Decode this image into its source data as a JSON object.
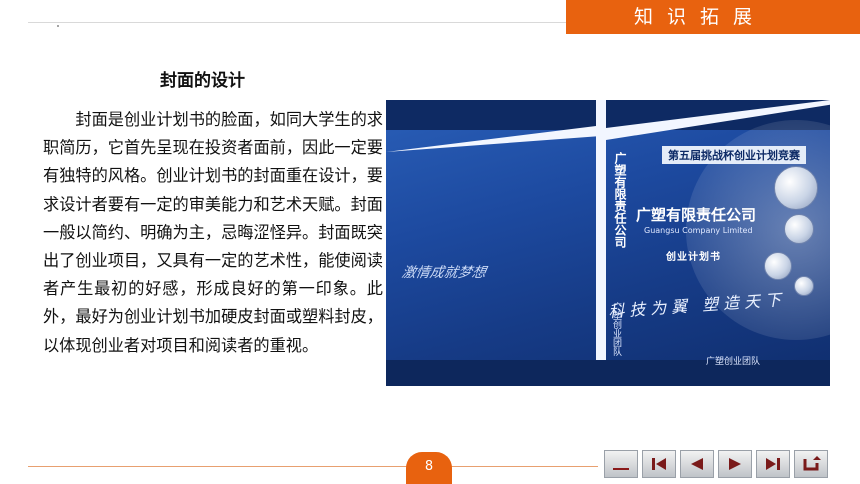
{
  "header": {
    "tab_label": "知识拓展"
  },
  "section": {
    "title": "封面的设计",
    "paragraph": "封面是创业计划书的脸面，如同大学生的求职简历，它首先呈现在投资者面前，因此一定要有独特的风格。创业计划书的封面重在设计，要求设计者要有一定的审美能力和艺术天赋。封面一般以简约、明确为主，忌晦涩怪异。封面既突出了创业项目，又具有一定的艺术性，能使阅读者产生最初的好感，形成良好的第一印象。此外，最好为创业计划书加硬皮封面或塑料封皮，以体现创业者对项目和阅读者的重视。"
  },
  "cover_image": {
    "spine_company": "广塑有限责任公司",
    "spine_team": "广塑创业团队",
    "contest": "第五届挑战杯创业计划竞赛",
    "company": "广塑有限责任公司",
    "company_en": "Guangsu Company Limited",
    "plan": "创业计划书",
    "slogan": "激情成就梦想",
    "calligraphy": "科技为翼 塑造天下",
    "team_bottom": "广塑创业团队"
  },
  "footer": {
    "page_number": "8",
    "nav_icons": [
      "blank-icon",
      "first-page-icon",
      "prev-page-icon",
      "next-page-icon",
      "last-page-icon",
      "return-icon"
    ]
  },
  "colors": {
    "accent": "#e8620f",
    "cover_blue": "#1d4aa0"
  }
}
